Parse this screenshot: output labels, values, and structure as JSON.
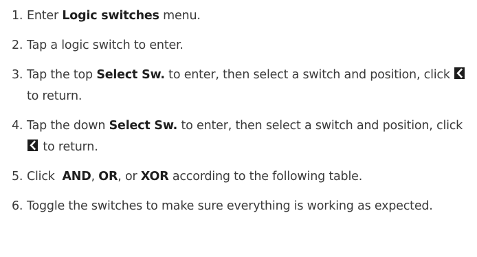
{
  "steps": [
    {
      "num": "1.",
      "parts": [
        "Enter ",
        "Logic switches",
        " menu."
      ]
    },
    {
      "num": "2.",
      "parts": [
        "Tap a logic switch to enter."
      ]
    },
    {
      "num": "3.",
      "parts": [
        "Tap the top ",
        "Select Sw.",
        " to enter, then select a switch and position, click ",
        " to return."
      ]
    },
    {
      "num": "4.",
      "parts": [
        "Tap the down ",
        "Select Sw.",
        " to enter, then select a switch and position, click ",
        " to return."
      ]
    },
    {
      "num": "5.",
      "parts": [
        "Click  ",
        "AND",
        ", ",
        "OR",
        ", or ",
        "XOR",
        " according to the following table."
      ]
    },
    {
      "num": "6.",
      "parts": [
        "Toggle the switches to make sure everything is working as expected."
      ]
    }
  ],
  "icons": {
    "back": "chevron-left-icon"
  }
}
